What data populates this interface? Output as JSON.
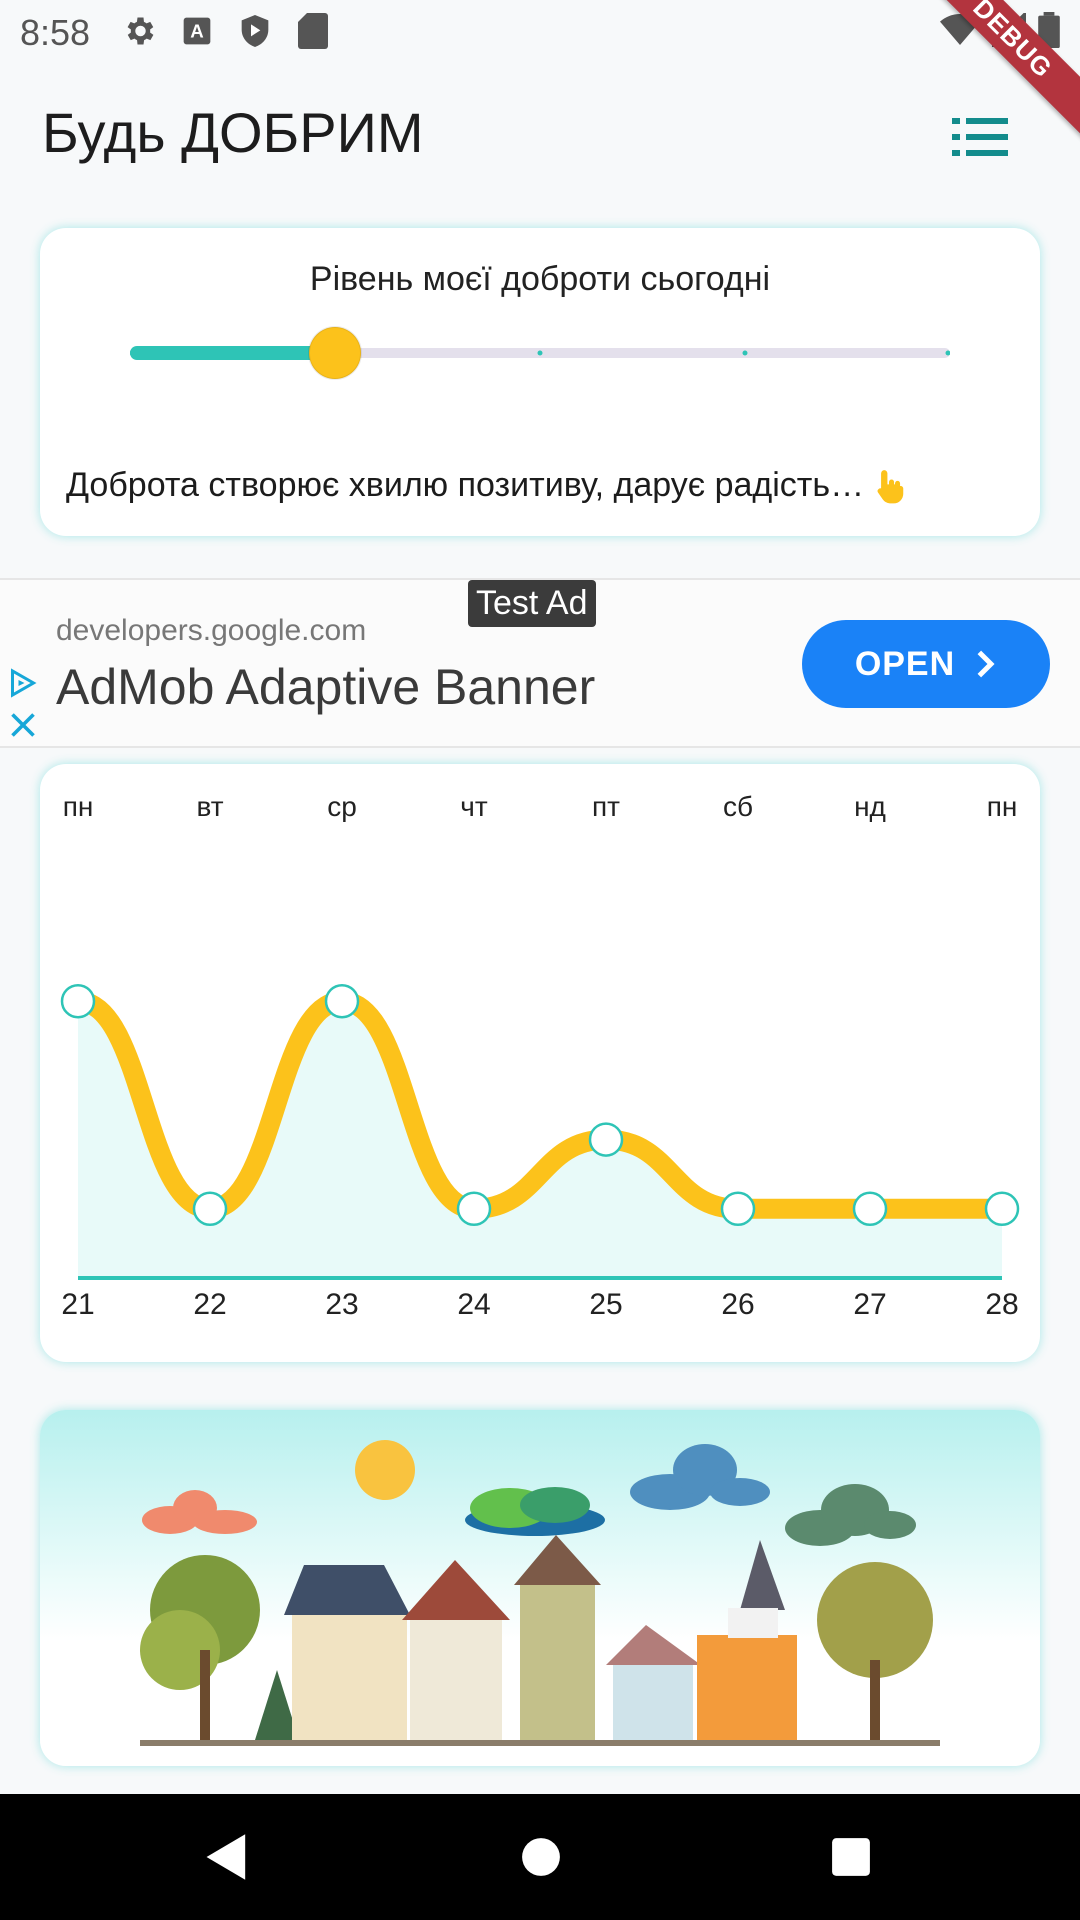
{
  "status": {
    "time": "8:58",
    "icons": [
      "gear-icon",
      "a-icon",
      "shield-play-icon",
      "sd-card-icon"
    ],
    "right_icons": [
      "wifi-icon",
      "signal-icon",
      "battery-icon"
    ]
  },
  "debug_label": "DEBUG",
  "appbar": {
    "title": "Будь ДОБРИМ",
    "menu_icon": "list-icon"
  },
  "kindness": {
    "title": "Рівень моєї доброти сьогодні",
    "slider_value_fraction": 0.25,
    "slider_divisions": 4,
    "text": "Доброта створює хвилю позитиву, дарує радість…",
    "icon": "pointing-hand-icon"
  },
  "ad": {
    "label": "Test Ad",
    "domain": "developers.google.com",
    "title": "AdMob Adaptive Banner",
    "button": "OPEN"
  },
  "chart_data": {
    "type": "line",
    "categories_top": [
      "пн",
      "вт",
      "ср",
      "чт",
      "пт",
      "сб",
      "нд",
      "пн"
    ],
    "categories_bottom": [
      "21",
      "22",
      "23",
      "24",
      "25",
      "26",
      "27",
      "28"
    ],
    "values": [
      4,
      1,
      4,
      1,
      2,
      1,
      1,
      1
    ],
    "ylim": [
      0,
      5
    ],
    "colors": {
      "line": "#fcc21b",
      "point_stroke": "#2ec4b6",
      "fill": "#e8faf9",
      "axis": "#2ec4b6"
    }
  },
  "colors": {
    "accent": "#2ec4b6",
    "thumb": "#fcc21b"
  }
}
